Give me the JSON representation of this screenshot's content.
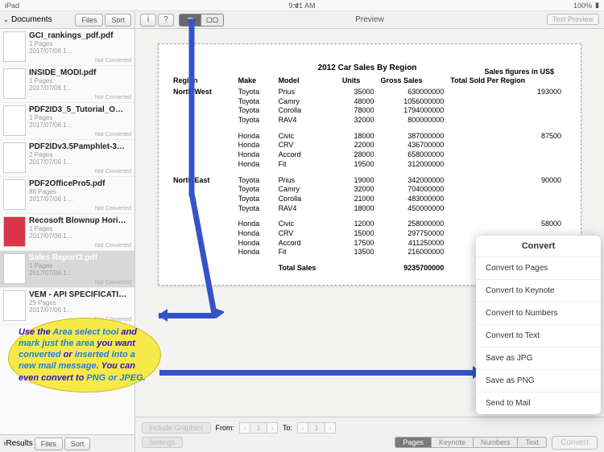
{
  "status": {
    "carrier": "iPad",
    "wifi": "ᯤ",
    "time": "9:41 AM",
    "battery": "100%"
  },
  "sidebar": {
    "title": "Documents",
    "files_btn": "Files",
    "sort_btn": "Sort",
    "items": [
      {
        "name": "GCI_rankings_pdf.pdf",
        "sub": "1 Pages",
        "date": "2017/07/06 1…",
        "status": "Not Converted"
      },
      {
        "name": "INSIDE_MODI.pdf",
        "sub": "1 Pages",
        "date": "2017/07/06 1…",
        "status": "Not Converted"
      },
      {
        "name": "PDF2ID3_5_Tutorial_O…",
        "sub": "1 Pages",
        "date": "2017/07/06 1…",
        "status": "Not Converted"
      },
      {
        "name": "PDF2IDv3.5Pamphlet-3…",
        "sub": "2 Pages",
        "date": "2017/07/06 1…",
        "status": "Not Converted"
      },
      {
        "name": "PDF2OfficePro5.pdf",
        "sub": "86 Pages",
        "date": "2017/07/06 1…",
        "status": "Not Converted"
      },
      {
        "name": "Recosoft Blownup Hori…",
        "sub": "1 Pages",
        "date": "2017/07/06 1…",
        "status": "Not Converted"
      },
      {
        "name": "Sales Report3.pdf",
        "sub": "1 Pages",
        "date": "2017/07/06 1…",
        "status": "Not Converted"
      },
      {
        "name": "VEM - API SPECIFICATI…",
        "sub": "29 Pages",
        "date": "2017/07/06 1…",
        "status": "Not Converted"
      }
    ],
    "results": "Results"
  },
  "preview": {
    "title": "Preview",
    "text_preview": "Text Preview",
    "doc_title": "2012 Car Sales By Region",
    "sales_caption": "Sales figures in US$",
    "headers": [
      "Region",
      "Make",
      "Model",
      "Units",
      "Gross Sales",
      "Total Sold Per Region"
    ],
    "total_label": "Total Sales",
    "total_value": "9235700000"
  },
  "chart_data": {
    "type": "table",
    "title": "2012 Car Sales By Region",
    "columns": [
      "Region",
      "Make",
      "Model",
      "Units",
      "Gross Sales",
      "Total Sold Per Region"
    ],
    "rows": [
      [
        "North West",
        "Toyota",
        "Prius",
        "35000",
        "630000000",
        "193000"
      ],
      [
        "",
        "Toyota",
        "Camry",
        "48000",
        "1056000000",
        ""
      ],
      [
        "",
        "Toyota",
        "Corolla",
        "78000",
        "1794000000",
        ""
      ],
      [
        "",
        "Toyota",
        "RAV4",
        "32000",
        "800000000",
        ""
      ],
      [
        "",
        "Honda",
        "Civic",
        "18000",
        "387000000",
        "87500"
      ],
      [
        "",
        "Honda",
        "CRV",
        "22000",
        "436700000",
        ""
      ],
      [
        "",
        "Honda",
        "Accord",
        "28000",
        "658000000",
        ""
      ],
      [
        "",
        "Honda",
        "Fit",
        "19500",
        "312000000",
        ""
      ],
      [
        "North East",
        "Toyota",
        "Prius",
        "19000",
        "342000000",
        "90000"
      ],
      [
        "",
        "Toyota",
        "Camry",
        "32000",
        "704000000",
        ""
      ],
      [
        "",
        "Toyota",
        "Corolla",
        "21000",
        "483000000",
        ""
      ],
      [
        "",
        "Toyota",
        "RAV4",
        "18000",
        "450000000",
        ""
      ],
      [
        "",
        "Honda",
        "Civic",
        "12000",
        "258000000",
        "58000"
      ],
      [
        "",
        "Honda",
        "CRV",
        "15000",
        "297750000",
        ""
      ],
      [
        "",
        "Honda",
        "Accord",
        "17500",
        "411250000",
        ""
      ],
      [
        "",
        "Honda",
        "Fit",
        "13500",
        "216000000",
        ""
      ]
    ],
    "total": [
      "Total Sales",
      "9235700000"
    ]
  },
  "footer": {
    "include_graphics": "Include Graphics",
    "from": "From:",
    "to": "To:",
    "page": "1",
    "settings": "Settings",
    "tabs": [
      "Pages",
      "Keynote",
      "Numbers",
      "Text"
    ],
    "convert": "Convert"
  },
  "popup": {
    "title": "Convert",
    "items": [
      "Convert to Pages",
      "Convert to Keynote",
      "Convert to Numbers",
      "Convert to Text",
      "Save as JPG",
      "Save as PNG",
      "Send to Mail"
    ]
  },
  "callout": {
    "l1": "Use the ",
    "h1": "Area select tool",
    "l2": " and ",
    "h2": "mark just the area",
    "l3": " you want ",
    "h3": "converted",
    "l4": " or ",
    "h4": "inserted into a new mail message.",
    "l5": " You can even convert to ",
    "h5": "PNG or JPEG."
  }
}
